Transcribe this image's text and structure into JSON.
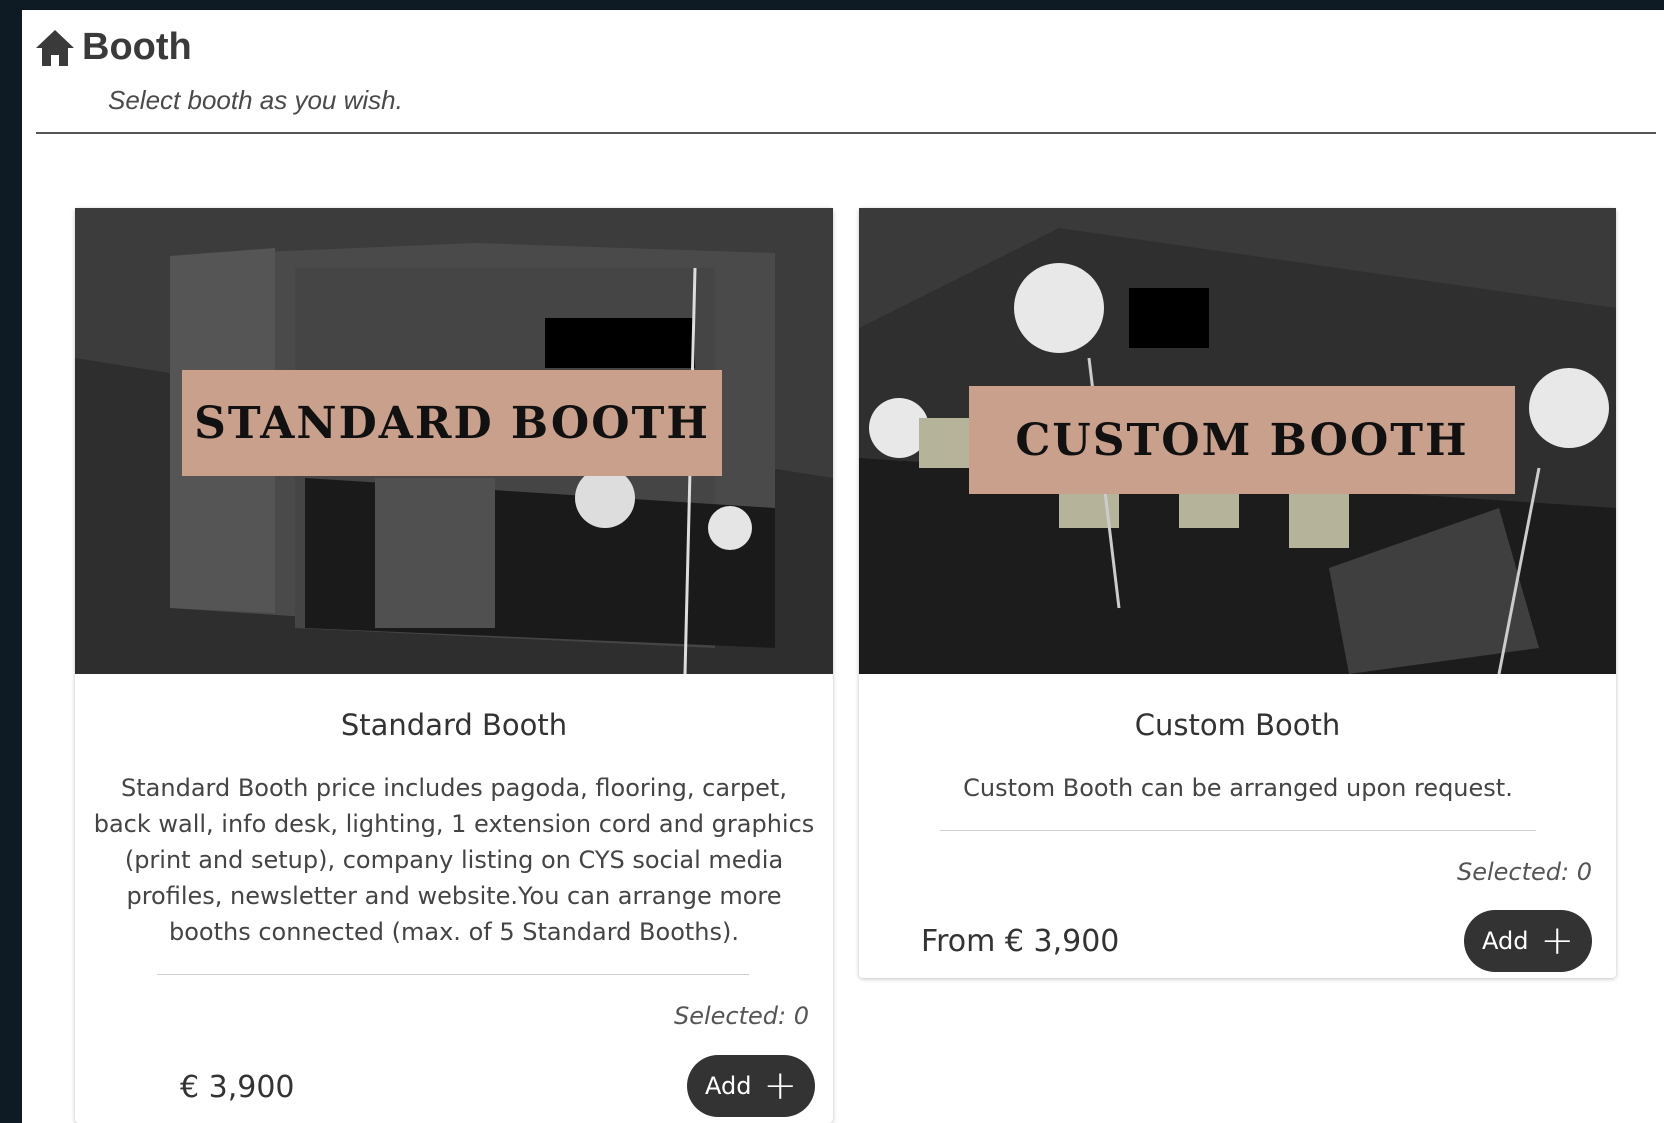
{
  "header": {
    "title": "Booth",
    "subtitle": "Select booth as you wish."
  },
  "cards": [
    {
      "image_label": "STANDARD BOOTH",
      "name": "Standard Booth",
      "description": "Standard Booth price includes pagoda, flooring, carpet, back wall, info desk, lighting, 1 extension cord and graphics (print and setup), company listing on CYS social media profiles, newsletter and website.You can arrange more booths connected (max. of 5 Standard Booths).",
      "selected": "Selected: 0",
      "price": "€ 3,900",
      "add_label": "Add",
      "add_icon": "plus-icon"
    },
    {
      "image_label": "CUSTOM BOOTH",
      "name": "Custom Booth",
      "description": "Custom Booth can be arranged upon request.",
      "selected": "Selected: 0",
      "price": "From € 3,900",
      "add_label": "Add",
      "add_icon": "plus-icon"
    }
  ],
  "colors": {
    "background": "#0e1b24",
    "label_bg": "#c9a08b",
    "button_bg": "#333333"
  }
}
